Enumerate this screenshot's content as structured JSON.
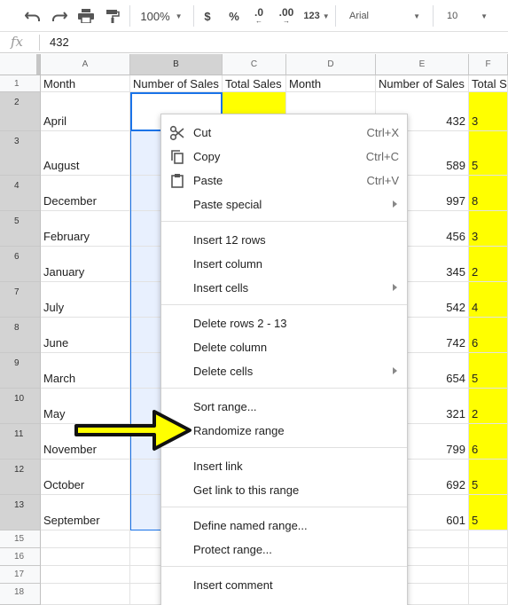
{
  "toolbar": {
    "zoom": "100%",
    "currency": "$",
    "percent": "%",
    "decrease_decimals": ".0",
    "increase_decimals": ".00",
    "more_formats": "123",
    "font": "Arial",
    "font_size": "10"
  },
  "formula_bar": {
    "fx_label": "fx",
    "value": "432"
  },
  "columns": [
    "A",
    "B",
    "C",
    "D",
    "E",
    "F"
  ],
  "rows": [
    "1",
    "2",
    "3",
    "4",
    "5",
    "6",
    "7",
    "8",
    "9",
    "10",
    "11",
    "12",
    "13",
    "15",
    "16",
    "17",
    "18"
  ],
  "headers": {
    "a": "Month",
    "b": "Number of Sales",
    "c": "Total Sales",
    "d": "Month",
    "e": "Number of Sales",
    "f": "Total Sales"
  },
  "data_rows": [
    {
      "month": "April",
      "sales": "432",
      "total": "3"
    },
    {
      "month": "August",
      "sales": "589",
      "total": "5"
    },
    {
      "month": "December",
      "sales": "997",
      "total": "8"
    },
    {
      "month": "February",
      "sales": "456",
      "total": "3"
    },
    {
      "month": "January",
      "sales": "345",
      "total": "2"
    },
    {
      "month": "July",
      "sales": "542",
      "total": "4"
    },
    {
      "month": "June",
      "sales": "742",
      "total": "6"
    },
    {
      "month": "March",
      "sales": "654",
      "total": "5"
    },
    {
      "month": "May",
      "sales": "321",
      "total": "2"
    },
    {
      "month": "November",
      "sales": "799",
      "total": "6"
    },
    {
      "month": "October",
      "sales": "692",
      "total": "5"
    },
    {
      "month": "September",
      "sales": "601",
      "total": "5"
    }
  ],
  "context_menu": {
    "cut": {
      "label": "Cut",
      "shortcut": "Ctrl+X"
    },
    "copy": {
      "label": "Copy",
      "shortcut": "Ctrl+C"
    },
    "paste": {
      "label": "Paste",
      "shortcut": "Ctrl+V"
    },
    "paste_special": {
      "label": "Paste special"
    },
    "insert_rows": {
      "label": "Insert 12 rows"
    },
    "insert_column": {
      "label": "Insert column"
    },
    "insert_cells": {
      "label": "Insert cells"
    },
    "delete_rows": {
      "label": "Delete rows 2 - 13"
    },
    "delete_column": {
      "label": "Delete column"
    },
    "delete_cells": {
      "label": "Delete cells"
    },
    "sort_range": {
      "label": "Sort range..."
    },
    "randomize_range": {
      "label": "Randomize range"
    },
    "insert_link": {
      "label": "Insert link"
    },
    "get_link": {
      "label": "Get link to this range"
    },
    "define_named_range": {
      "label": "Define named range..."
    },
    "protect_range": {
      "label": "Protect range..."
    },
    "insert_comment": {
      "label": "Insert comment"
    }
  },
  "colors": {
    "highlight_fill": "#ffff00",
    "selection_border": "#1a73e8",
    "selection_fill": "#e8f0fe",
    "annotation_arrow": "#ffff00"
  }
}
